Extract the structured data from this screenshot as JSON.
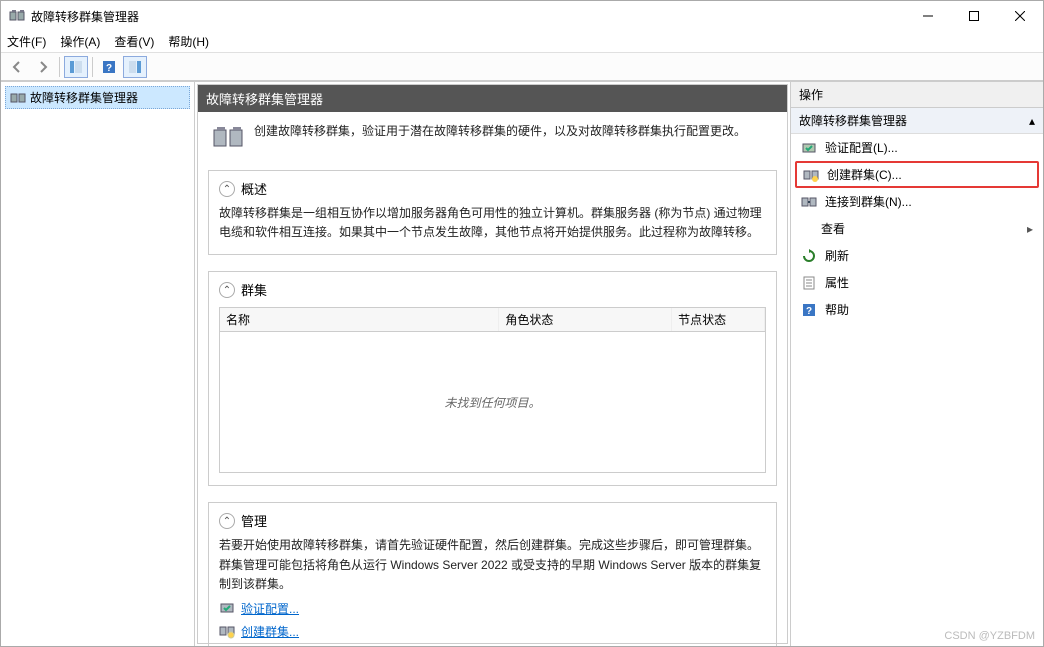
{
  "window": {
    "title": "故障转移群集管理器"
  },
  "menu": {
    "file": "文件(F)",
    "action": "操作(A)",
    "view": "查看(V)",
    "help": "帮助(H)"
  },
  "tree": {
    "root": "故障转移群集管理器"
  },
  "center": {
    "header": "故障转移群集管理器",
    "intro": "创建故障转移群集，验证用于潜在故障转移群集的硬件，以及对故障转移群集执行配置更改。",
    "overview": {
      "title": "概述",
      "text": "故障转移群集是一组相互协作以增加服务器角色可用性的独立计算机。群集服务器 (称为节点) 通过物理电缆和软件相互连接。如果其中一个节点发生故障，其他节点将开始提供服务。此过程称为故障转移。"
    },
    "clusters": {
      "title": "群集",
      "cols": {
        "name": "名称",
        "rolestatus": "角色状态",
        "nodestatus": "节点状态"
      },
      "empty": "未找到任何项目。"
    },
    "manage": {
      "title": "管理",
      "text": "若要开始使用故障转移群集，请首先验证硬件配置，然后创建群集。完成这些步骤后，即可管理群集。群集管理可能包括将角色从运行 Windows Server 2022 或受支持的早期 Windows Server 版本的群集复制到该群集。",
      "link_validate": "验证配置...",
      "link_create": "创建群集..."
    }
  },
  "actions": {
    "title": "操作",
    "group": "故障转移群集管理器",
    "validate": "验证配置(L)...",
    "create": "创建群集(C)...",
    "connect": "连接到群集(N)...",
    "view": "查看",
    "refresh": "刷新",
    "properties": "属性",
    "help": "帮助"
  },
  "watermark": "CSDN @YZBFDM"
}
